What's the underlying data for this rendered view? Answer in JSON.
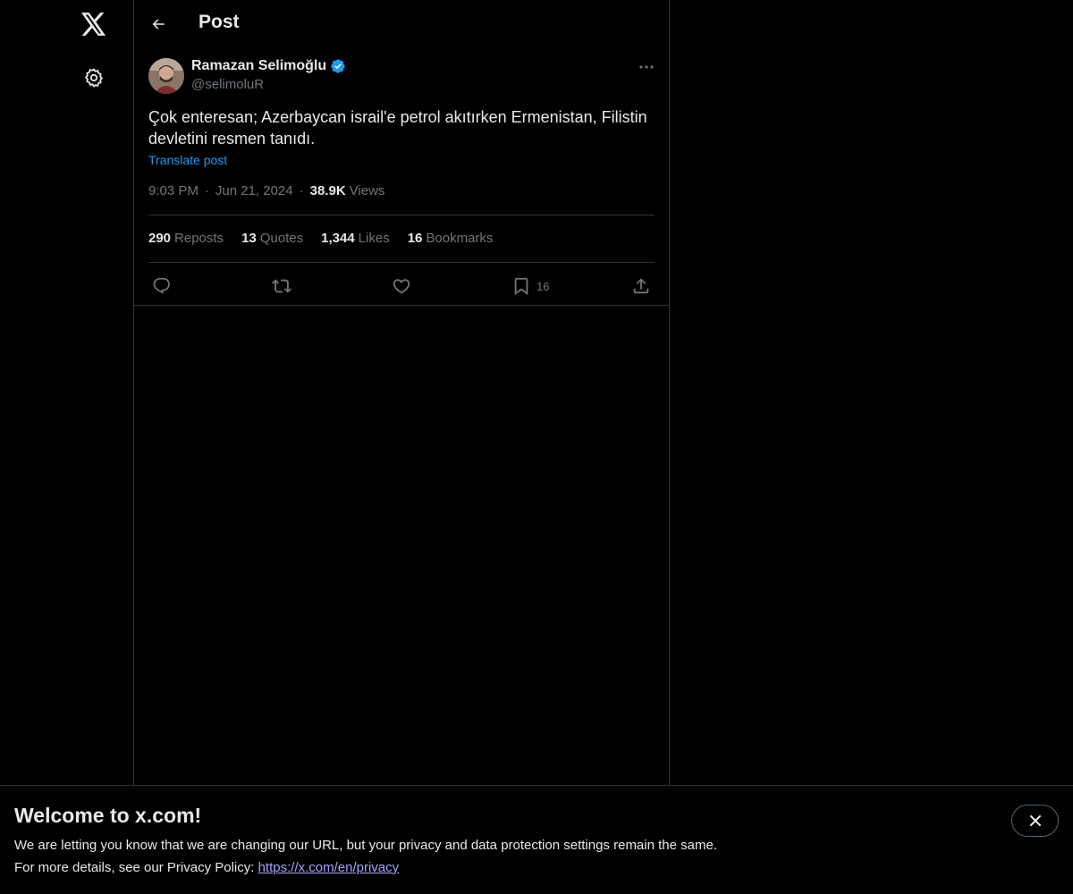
{
  "nav": {
    "logo_icon": "x-logo-icon",
    "settings_icon": "gear-icon"
  },
  "header": {
    "title": "Post"
  },
  "post": {
    "author_name": "Ramazan Selimoğlu",
    "author_handle": "@selimoluR",
    "verified": true,
    "text_line1": "Çok enteresan; Azerbaycan israil'e petrol akıtırken Ermenistan, Filistin",
    "text_line2": "devletini resmen tanıdı.",
    "translate_label": "Translate post",
    "time": "9:03 PM",
    "date": "Jun 21, 2024",
    "views_count": "38.9K",
    "views_label": "Views",
    "stats": [
      {
        "num": "290",
        "label": "Reposts"
      },
      {
        "num": "13",
        "label": "Quotes"
      },
      {
        "num": "1,344",
        "label": "Likes"
      },
      {
        "num": "16",
        "label": "Bookmarks"
      }
    ],
    "bookmark_count": "16"
  },
  "banner": {
    "title": "Welcome to x.com!",
    "line1": "We are letting you know that we are changing our URL, but your privacy and data protection settings remain the same.",
    "line2_prefix": "For more details, see our Privacy Policy: ",
    "link": "https://x.com/en/privacy"
  },
  "colors": {
    "background": "#000000",
    "text": "#e7e9ea",
    "muted": "#71767b",
    "accent": "#1d9bf0",
    "border": "#2f3336",
    "link": "#a6a3f7"
  }
}
